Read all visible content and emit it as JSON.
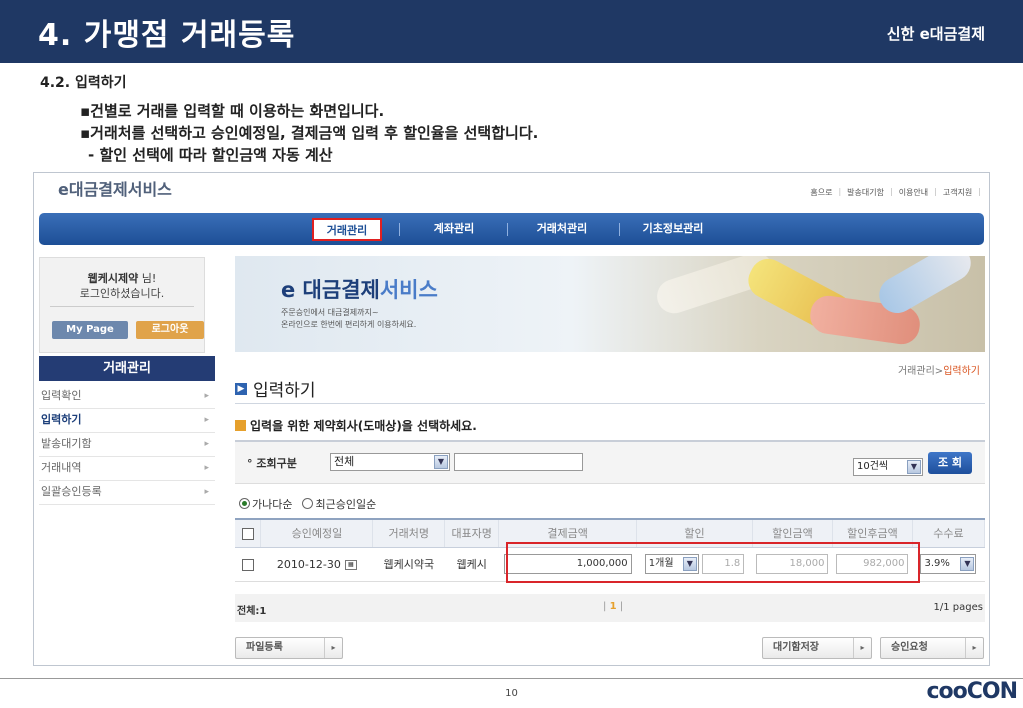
{
  "slide": {
    "title": "4. 가맹점 거래등록",
    "brand": "신한 e대금결제",
    "subheading": "4.2. 입력하기",
    "bullets": [
      "▪건별로 거래를 입력할 때 이용하는 화면입니다.",
      "▪거래처를 선택하고 승인예정일, 결제금액 입력 후 할인율을 선택합니다.",
      "- 할인 선택에 따라 할인금액 자동 계산"
    ],
    "page_number": "10",
    "footer_logo": "cooCON"
  },
  "app": {
    "logo": "e대금결제서비스",
    "util_links": [
      "홈으로",
      "발송대기함",
      "이용안내",
      "고객지원"
    ],
    "gnb": [
      "거래관리",
      "계좌관리",
      "거래처관리",
      "기초정보관리"
    ],
    "login": {
      "company": "웹케시제약",
      "suffix": " 님!",
      "message": "로그인하셨습니다.",
      "mypage": "My Page",
      "logout": "로그아웃"
    },
    "side_title": "거래관리",
    "side_menu": [
      "입력확인",
      "입력하기",
      "발송대기함",
      "거래내역",
      "일괄승인등록"
    ],
    "banner": {
      "title_e": "e 대금결제",
      "title_rest": "서비스",
      "line1": "주문승인에서 대금결제까지~",
      "line2": "온라인으로 한번에 편리하게 이용하세요."
    },
    "breadcrumb": {
      "parent": "거래관리",
      "sep": ">",
      "current": "입력하기"
    },
    "page_heading": "입력하기",
    "select_heading": "입력을 위한 제약회사(도매상)을 선택하세요.",
    "search": {
      "label": "° 조회구분",
      "select_value": "전체",
      "input_value": "",
      "page_size": "10건씩",
      "button": "조 회"
    },
    "sort": [
      "가나다순",
      "최근승인일순"
    ],
    "table": {
      "headers": [
        "승인예정일",
        "거래처명",
        "대표자명",
        "결제금액",
        "할인",
        "할인금액",
        "할인후금액",
        "수수료"
      ],
      "row": {
        "date": "2010-12-30",
        "partner": "웹케시약국",
        "rep": "웹케시",
        "amount": "1,000,000",
        "discount_period": "1개월",
        "discount_rate": "1.8",
        "discount_amount": "18,000",
        "after_amount": "982,000",
        "fee": "3.9%"
      }
    },
    "pager": {
      "total": "전체:1",
      "current": "1",
      "pages": "1/1 pages"
    },
    "buttons": {
      "file": "파일등록",
      "save": "대기함저장",
      "approve": "승인요청"
    }
  }
}
